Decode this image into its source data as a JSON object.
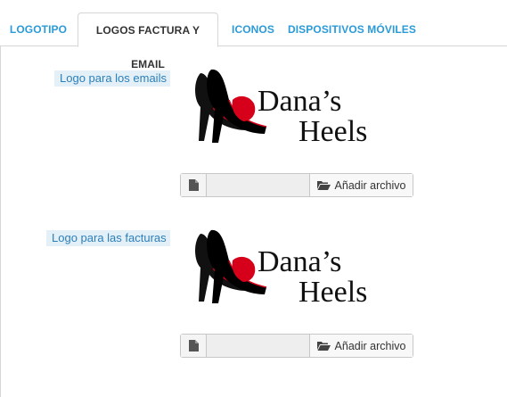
{
  "tabs": [
    {
      "label": "LOGOTIPO"
    },
    {
      "label": "LOGOS FACTURA Y EMAIL"
    },
    {
      "label": "ICONOS"
    },
    {
      "label": "DISPOSITIVOS MÓVILES"
    }
  ],
  "sections": [
    {
      "label": "Logo para los emails",
      "logo_line1": "Dana’s",
      "logo_line2": "Heels",
      "upload_button": "Añadir archivo"
    },
    {
      "label": "Logo para las facturas",
      "logo_line1": "Dana’s",
      "logo_line2": "Heels",
      "upload_button": "Añadir archivo"
    }
  ],
  "icons": {
    "file": "file-icon",
    "folder_open": "folder-open-icon"
  },
  "colors": {
    "tab_text": "#2a9bd8",
    "label_text": "#2c7fb8",
    "label_bg": "#e4f0f8",
    "logo_red": "#d7001a"
  }
}
